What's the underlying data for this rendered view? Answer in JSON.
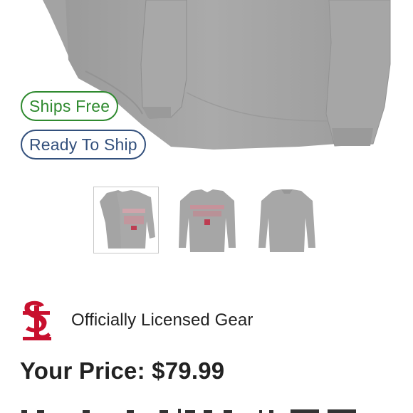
{
  "badges": {
    "ships_free": "Ships Free",
    "ready_to_ship": "Ready To Ship"
  },
  "product": {
    "thumbnails": [
      {
        "name": "front-graphic-view",
        "selected": true
      },
      {
        "name": "front-view",
        "selected": false
      },
      {
        "name": "back-view",
        "selected": false
      }
    ]
  },
  "licensing": {
    "logo_icon": "cardinals-stl-logo-icon",
    "text": "Officially Licensed Gear"
  },
  "pricing": {
    "label": "Your Price: $79.99"
  },
  "colors": {
    "ships_free": "#2f8a2f",
    "ready_to_ship": "#33507c",
    "logo_red": "#c8102e",
    "shirt_gray": "#a5a5a5"
  }
}
